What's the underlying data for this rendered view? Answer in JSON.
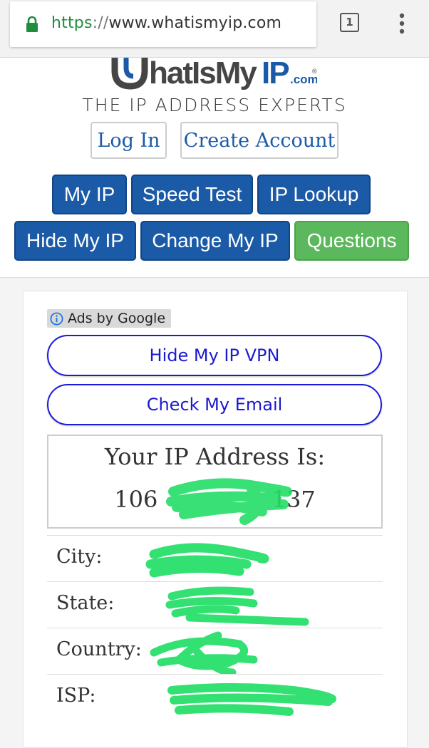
{
  "browser": {
    "url_scheme": "https",
    "url_separator": "://",
    "url_host": "www.whatismyip.com",
    "tab_count": "1",
    "icons": [
      "lock-icon",
      "tabs-icon",
      "overflow-menu-icon"
    ]
  },
  "header": {
    "logo_text": "WhatIsMyIP.com",
    "tagline": "THE IP ADDRESS EXPERTS",
    "login_label": "Log In",
    "create_account_label": "Create Account"
  },
  "nav": [
    {
      "label": "My IP"
    },
    {
      "label": "Speed Test"
    },
    {
      "label": "IP Lookup"
    },
    {
      "label": "Hide My IP"
    },
    {
      "label": "Change My IP"
    },
    {
      "label": "Questions"
    }
  ],
  "ads": {
    "label": "Ads by Google",
    "buttons": [
      "Hide My IP VPN",
      "Check My Email"
    ]
  },
  "ip": {
    "title": "Your IP Address Is:",
    "value_start": "106",
    "value_end": "137"
  },
  "details": [
    {
      "key": "City:",
      "value": ""
    },
    {
      "key": "State:",
      "value": ""
    },
    {
      "key": "Country:",
      "value": ""
    },
    {
      "key": "ISP:",
      "value": ""
    }
  ],
  "colors": {
    "nav_blue": "#1b5aa6",
    "questions_green": "#5cb85c",
    "ad_blue": "#1a1adb",
    "redaction_green": "#22dd66"
  }
}
